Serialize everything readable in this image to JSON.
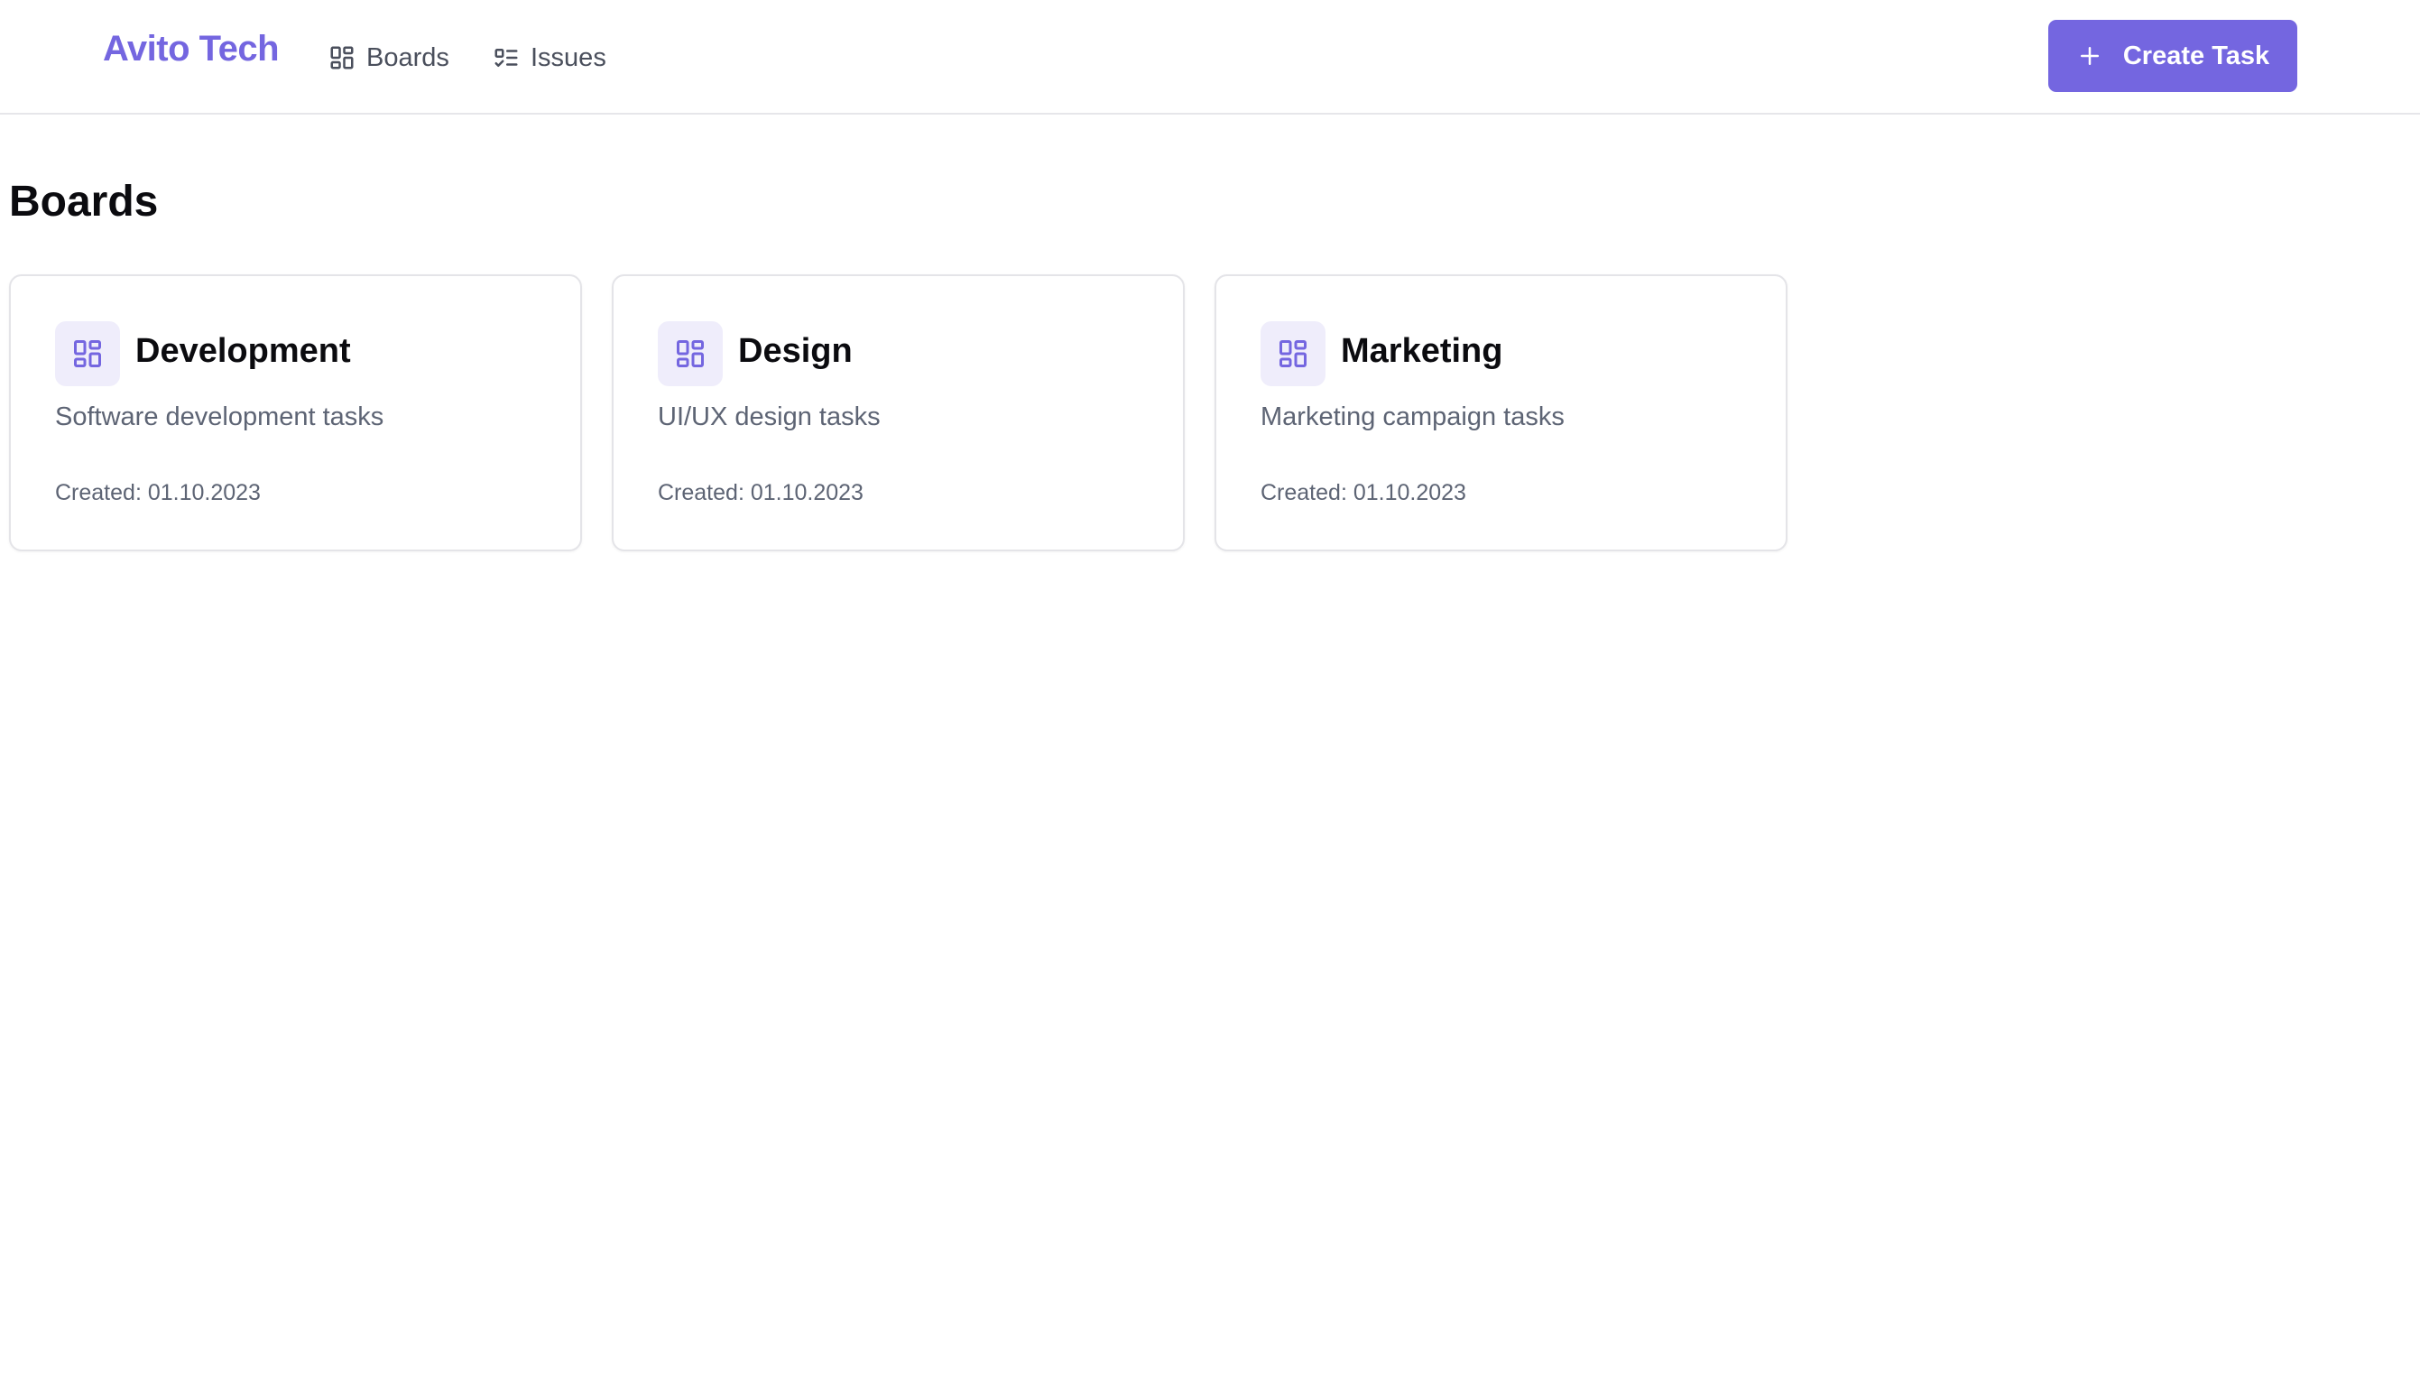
{
  "header": {
    "logo": "Avito Tech",
    "nav": [
      {
        "label": "Boards",
        "icon": "layout-dashboard-icon"
      },
      {
        "label": "Issues",
        "icon": "list-checks-icon"
      }
    ],
    "create_button": {
      "label": "Create Task",
      "icon": "plus-icon"
    }
  },
  "page": {
    "title": "Boards"
  },
  "boards": [
    {
      "name": "Development",
      "description": "Software development tasks",
      "created": "Created: 01.10.2023",
      "icon": "layout-dashboard-icon"
    },
    {
      "name": "Design",
      "description": "UI/UX design tasks",
      "created": "Created: 01.10.2023",
      "icon": "layout-dashboard-icon"
    },
    {
      "name": "Marketing",
      "description": "Marketing campaign tasks",
      "created": "Created: 01.10.2023",
      "icon": "layout-dashboard-icon"
    }
  ],
  "colors": {
    "accent": "#7466e0",
    "accent_soft": "#efedfb",
    "muted_text": "#5d6474",
    "border": "#e4e4e8"
  }
}
